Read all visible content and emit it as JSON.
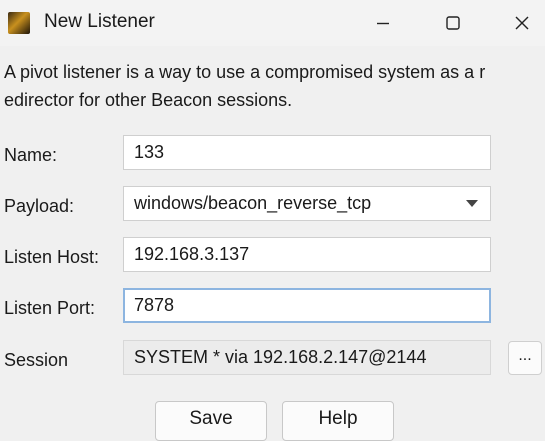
{
  "window": {
    "title": "New Listener",
    "controls": {
      "minimize_icon": "minimize-icon",
      "maximize_icon": "maximize-icon",
      "close_icon": "close-icon"
    }
  },
  "description": "A pivot listener is a way to use a compromised system as a r\nedirector for other Beacon sessions.",
  "form": {
    "name": {
      "label": "Name:",
      "value": "133"
    },
    "payload": {
      "label": "Payload:",
      "value": "windows/beacon_reverse_tcp"
    },
    "listen_host": {
      "label": "Listen Host:",
      "value": "192.168.3.137"
    },
    "listen_port": {
      "label": "Listen Port:",
      "value": "7878"
    },
    "session": {
      "label": "Session",
      "value": "SYSTEM * via  192.168.2.147@2144",
      "browse_label": "..."
    }
  },
  "buttons": {
    "save_label": "Save",
    "help_label": "Help"
  },
  "colors": {
    "background": "#f0f0f0",
    "focus_border": "#8db5e0"
  }
}
